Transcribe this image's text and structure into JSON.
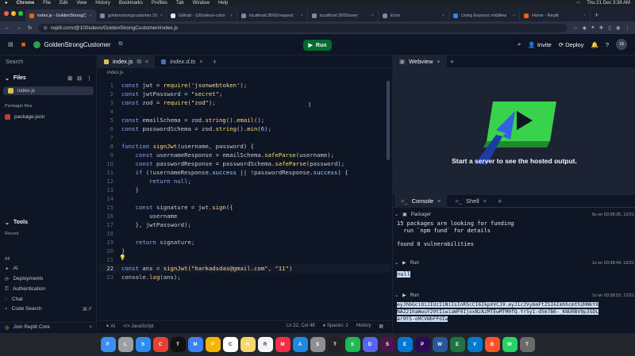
{
  "menubar": {
    "app": "Chrome",
    "items": [
      "File",
      "Edit",
      "View",
      "History",
      "Bookmarks",
      "Profiles",
      "Tab",
      "Window",
      "Help"
    ],
    "clock": "Thu 21 Dec 3:38 AM"
  },
  "browser_tabs": [
    {
      "title": "index.js - GoldenStrongC",
      "active": true
    },
    {
      "title": "goldenstrongcustomer.10",
      "active": false
    },
    {
      "title": "Github - 100xdevs-coho",
      "active": false
    },
    {
      "title": "localhost:3000/request",
      "active": false
    },
    {
      "title": "localhost:3000/user",
      "active": false
    },
    {
      "title": "Error",
      "active": false
    },
    {
      "title": "Using Express middlew",
      "active": false
    },
    {
      "title": "Home - Replit",
      "active": false
    }
  ],
  "url": "replit.com/@100xdevs/GoldenStrongCustomer#index.js",
  "replit": {
    "repl_name": "GoldenStrongCustomer",
    "run_label": "Run",
    "invite_label": "Invite",
    "deploy_label": "Deploy",
    "avatar_text": "18"
  },
  "sidebar": {
    "search_label": "Search",
    "files_label": "Files",
    "files": [
      "index.js"
    ],
    "packager_label": "Packager files",
    "packager_files": [
      "package.json"
    ],
    "tools_label": "Tools",
    "recent_label": "Recent",
    "all_label": "All",
    "tools": [
      "AI",
      "Deployments",
      "Authentication",
      "Chat",
      "Code Search"
    ],
    "code_search_shortcut": "⌘ F",
    "join_core_label": "Join Replit Core"
  },
  "editor": {
    "tabs": [
      {
        "label": "index.js",
        "active": true
      },
      {
        "label": "index.d.ts",
        "active": false
      }
    ],
    "breadcrumb": "index.js",
    "status": {
      "ai": "AI",
      "lang": "JavaScript",
      "cursor": "Ln 22, Col 48",
      "spaces": "Spaces: 2",
      "history": "History"
    },
    "lines": [
      {
        "n": "1",
        "html": "<span class='kw'>const</span> jwt = <span class='fn'>require</span>(<span class='str'>'jsonwebtoken'</span>);"
      },
      {
        "n": "2",
        "html": "<span class='kw'>const</span> jwtPassword = <span class='str'>\"secret\"</span>;"
      },
      {
        "n": "3",
        "html": "<span class='kw'>const</span> zod = <span class='fn'>require</span>(<span class='str'>\"zod\"</span>);"
      },
      {
        "n": "4",
        "html": ""
      },
      {
        "n": "5",
        "html": "<span class='kw'>const</span> emailSchema = zod.<span class='fn'>string</span>().<span class='fn'>email</span>();"
      },
      {
        "n": "6",
        "html": "<span class='kw'>const</span> passwordSchema = zod.<span class='fn'>string</span>().<span class='fn'>min</span>(<span class='pr'>6</span>);"
      },
      {
        "n": "7",
        "html": ""
      },
      {
        "n": "8",
        "html": "<span class='kw'>function</span> <span class='fn'>signJwt</span>(username, password) {"
      },
      {
        "n": "9",
        "html": "    <span class='kw'>const</span> usernameResponse = emailSchema.<span class='fn'>safeParse</span>(username);"
      },
      {
        "n": "10",
        "html": "    <span class='kw'>const</span> passwordResponse = passwordSchema.<span class='fn'>safeParse</span>(password);"
      },
      {
        "n": "11",
        "html": "    <span class='kw'>if</span> (!usernameResponse.<span class='pr'>success</span> || !passwordResponse.<span class='pr'>success</span>) {"
      },
      {
        "n": "12",
        "html": "        <span class='kw'>return</span> <span class='kw'>null</span>;"
      },
      {
        "n": "13",
        "html": "    }"
      },
      {
        "n": "14",
        "html": ""
      },
      {
        "n": "15",
        "html": "    <span class='kw'>const</span> signature = jwt.<span class='fn'>sign</span>({"
      },
      {
        "n": "16",
        "html": "        username"
      },
      {
        "n": "17",
        "html": "    }, jwtPassword);"
      },
      {
        "n": "18",
        "html": ""
      },
      {
        "n": "19",
        "html": "    <span class='kw'>return</span> signature;"
      },
      {
        "n": "20",
        "html": "}"
      },
      {
        "n": "21",
        "html": ""
      },
      {
        "n": "22",
        "html": "<span class='kw'>const</span> ans = <span class='fn'>signJwt</span>(<span class='str'>\"harkadsdas@gmail.com\"</span>, <span class='str'>\"11\"</span>)"
      },
      {
        "n": "23",
        "html": "console.<span class='fn'>log</span>(ans);"
      }
    ]
  },
  "webview": {
    "tab_label": "Webview",
    "message": "Start a server to see the hosted output."
  },
  "console": {
    "tabs": [
      {
        "label": "Console",
        "active": true
      },
      {
        "label": "Shell",
        "active": false
      }
    ],
    "packager_label": "Packager",
    "packager_time": "9s on 03:38:35, 12/21",
    "packager_out": [
      "15 packages are looking for funding",
      "  run `npm fund` for details",
      "",
      "found 0 vulnerabilities"
    ],
    "run1_label": "Run",
    "run1_time": "1s on 03:38:44, 12/21",
    "run1_out": "null",
    "run2_label": "Run",
    "run2_time": "1s on 03:38:53, 12/21",
    "run2_out": [
      "eyJhbGciOiJIUzI1NiIsInR5cCI6IkpXVCJ9.eyJ1c2VybmFtZSI6Imhhcmth2HNkYX",
      "NAZ21haWwuY29tIiwiaWF0IjoxNzAzMTEwMTM0fQ.Yr5y1-d5m7B6-_KNU0BV9p3SDL",
      "ar9t5-oMCVWbFPdIw"
    ]
  },
  "dock": [
    "Finder",
    "Launchpad",
    "Safari",
    "Chrome",
    "TV",
    "Mail",
    "Photos",
    "Calendar",
    "Notes",
    "Reminders",
    "Music",
    "App Store",
    "Settings",
    "Terminal",
    "Spotify",
    "Discord",
    "Slack",
    "Edge",
    "Premiere",
    "Word",
    "Excel",
    "VS Code",
    "Brave",
    "WhatsApp",
    "Trash"
  ]
}
